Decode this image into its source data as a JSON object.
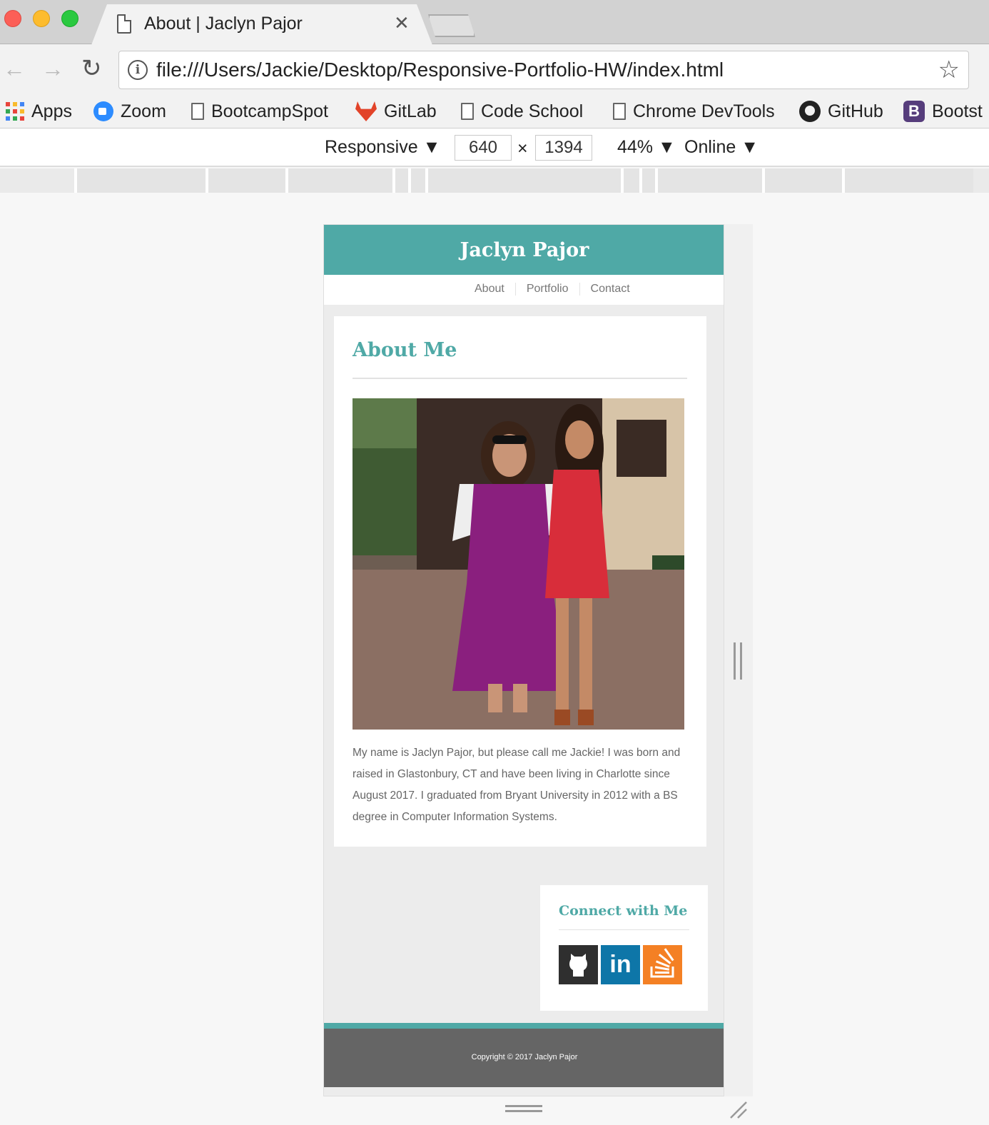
{
  "browser": {
    "tab_title": "About | Jaclyn Pajor",
    "tab_close_glyph": "✕",
    "url": "file:///Users/Jackie/Desktop/Responsive-Portfolio-HW/index.html",
    "nav": {
      "back": "←",
      "forward": "→",
      "reload": "↻",
      "star": "☆"
    },
    "bookmarks": [
      "Apps",
      "Zoom",
      "BootcampSpot",
      "GitLab",
      "Code School",
      "Chrome DevTools",
      "GitHub",
      "Bootst"
    ],
    "bookmark_icons": [
      "apps-grid-icon",
      "zoom-icon",
      "page-icon",
      "gitlab-icon",
      "page-icon",
      "page-icon",
      "github-icon",
      "bootstrap-icon"
    ]
  },
  "devtools": {
    "device": "Responsive",
    "width": "640",
    "times": "×",
    "height": "1394",
    "zoom": "44%",
    "network": "Online",
    "caret": "▼"
  },
  "site": {
    "title": "Jaclyn Pajor",
    "nav": [
      "About",
      "Portfolio",
      "Contact"
    ],
    "about": {
      "heading": "About Me",
      "photo_alt": "photo-of-two-women",
      "body": "My name is Jaclyn Pajor, but please call me Jackie! I was born and raised in Glastonbury, CT and have been living in Charlotte since August 2017. I graduated from Bryant University in 2012 with a BS degree in Computer Information Systems."
    },
    "connect": {
      "heading": "Connect with Me",
      "icons": [
        "github-icon",
        "linkedin-icon",
        "stackoverflow-icon"
      ],
      "linkedin_glyph": "in"
    },
    "footer": "Copyright © 2017 Jaclyn Pajor"
  },
  "colors": {
    "accent": "#4fa9a6",
    "footer": "#656565",
    "linkedin": "#0e76a8",
    "stackoverflow": "#f48024",
    "github": "#2f2f2f"
  }
}
